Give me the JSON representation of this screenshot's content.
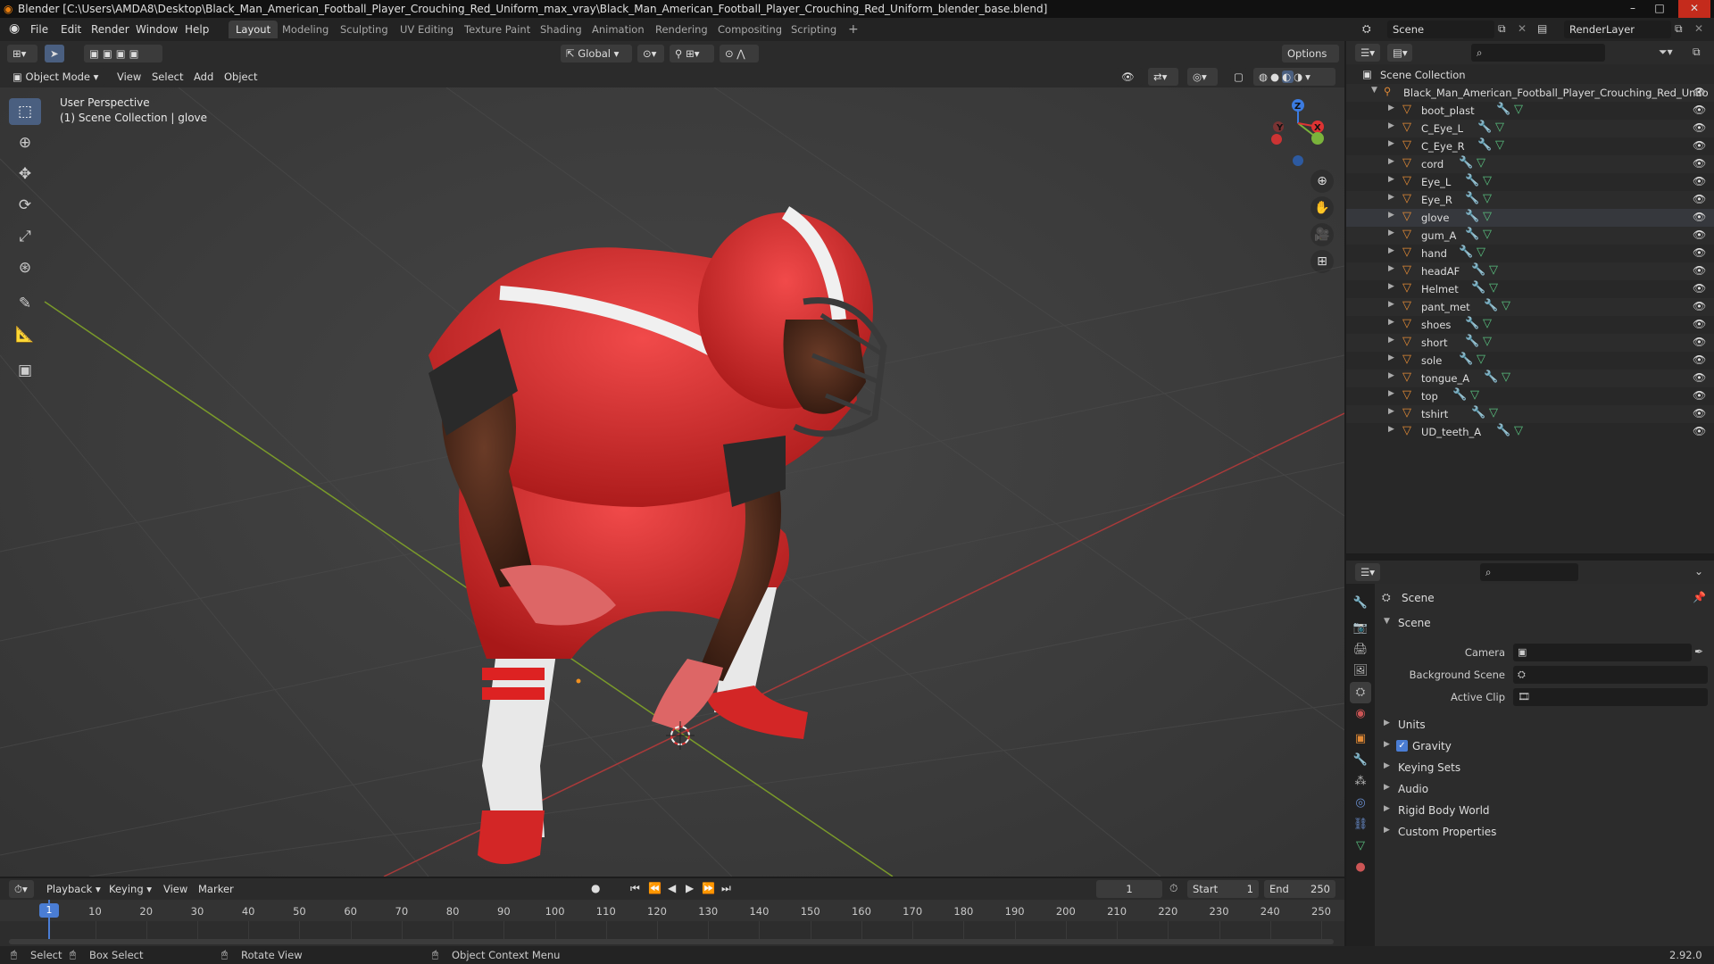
{
  "titlebar": {
    "title": "Blender [C:\\Users\\AMDA8\\Desktop\\Black_Man_American_Football_Player_Crouching_Red_Uniform_max_vray\\Black_Man_American_Football_Player_Crouching_Red_Uniform_blender_base.blend]",
    "minimize": "–",
    "maximize": "□",
    "close": "✕"
  },
  "menu": [
    "File",
    "Edit",
    "Render",
    "Window",
    "Help"
  ],
  "workspaces": [
    "Layout",
    "Modeling",
    "Sculpting",
    "UV Editing",
    "Texture Paint",
    "Shading",
    "Animation",
    "Rendering",
    "Compositing",
    "Scripting"
  ],
  "workspace_add": "+",
  "scene_name": "Scene",
  "renderlayer_name": "RenderLayer",
  "viewport": {
    "transform_orientation": "Global",
    "options": "Options",
    "mode": "Object Mode",
    "header_menus": [
      "View",
      "Select",
      "Add",
      "Object"
    ],
    "perspective_label": "User Perspective",
    "collection_label": "(1) Scene Collection | glove",
    "gizmo": {
      "x": "X",
      "y": "Y",
      "z": "Z"
    }
  },
  "tool_icons": [
    "select-box-icon",
    "cursor-icon",
    "move-icon",
    "rotate-icon",
    "scale-icon",
    "transform-icon",
    "annotate-icon",
    "measure-icon",
    "add-cube-icon"
  ],
  "outliner": {
    "root": "Scene Collection",
    "collection": "Black_Man_American_Football_Player_Crouching_Red_Unifo",
    "objects": [
      "boot_plast",
      "C_Eye_L",
      "C_Eye_R",
      "cord",
      "Eye_L",
      "Eye_R",
      "glove",
      "gum_A",
      "hand",
      "headAF",
      "Helmet",
      "pant_met",
      "shoes",
      "short",
      "sole",
      "tongue_A",
      "top",
      "tshirt",
      "UD_teeth_A"
    ],
    "selected": "glove"
  },
  "properties": {
    "context": "Scene",
    "panel_title": "Scene",
    "fields": [
      {
        "label": "Camera",
        "value": ""
      },
      {
        "label": "Background Scene",
        "value": ""
      },
      {
        "label": "Active Clip",
        "value": ""
      }
    ],
    "panels": [
      "Units",
      "Gravity",
      "Keying Sets",
      "Audio",
      "Rigid Body World",
      "Custom Properties"
    ],
    "gravity_checked": true
  },
  "timeline": {
    "menus": [
      "Playback",
      "Keying",
      "View",
      "Marker"
    ],
    "current_frame": "1",
    "start_label": "Start",
    "start": "1",
    "end_label": "End",
    "end": "250",
    "ticks": [
      "10",
      "20",
      "30",
      "40",
      "50",
      "60",
      "70",
      "80",
      "90",
      "100",
      "110",
      "120",
      "130",
      "140",
      "150",
      "160",
      "170",
      "180",
      "190",
      "200",
      "210",
      "220",
      "230",
      "240",
      "250"
    ]
  },
  "statusbar": {
    "select": "Select",
    "box_select": "Box Select",
    "rotate_view": "Rotate View",
    "context_menu": "Object Context Menu",
    "version": "2.92.0"
  }
}
